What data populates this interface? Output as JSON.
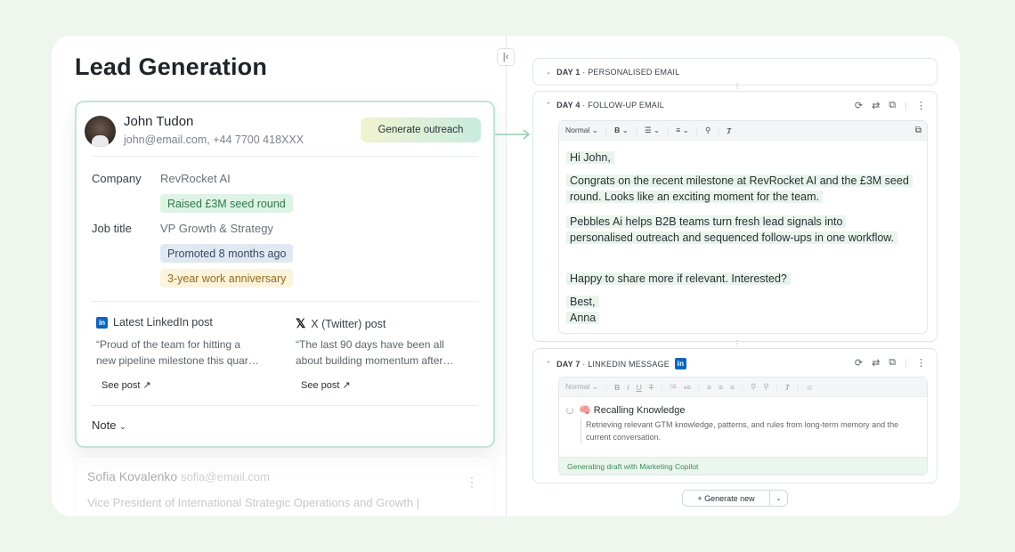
{
  "page": {
    "title": "Lead Generation"
  },
  "lead": {
    "name": "John Tudon",
    "contact": "john@email.com, +44 7700 418XXX",
    "generate_label": "Generate outreach",
    "company_label": "Company",
    "company": "RevRocket AI",
    "company_tag": "Raised £3M seed round",
    "job_label": "Job title",
    "job": "VP Growth & Strategy",
    "job_tags": [
      "Promoted 8 months ago",
      "3-year work anniversary"
    ],
    "linkedin": {
      "header": "Latest LinkedIn post",
      "lines": [
        "“Proud of the team for hitting a",
        "new pipeline milestone this quar…"
      ],
      "see": "See post ↗"
    },
    "twitter": {
      "header": "X (Twitter) post",
      "lines": [
        "“The last 90 days have been all",
        "about building momentum after…"
      ],
      "see": "See post ↗"
    },
    "note_label": "Note"
  },
  "next_lead": {
    "name": "Sofia Kovalenko",
    "email": "sofia@email.com",
    "title": "Vice President of International Strategic Operations and Growth |"
  },
  "sequence": {
    "day1": {
      "day": "DAY 1",
      "label": " · PERSONALISED EMAIL"
    },
    "day4": {
      "day": "DAY 4",
      "label": " · FOLLOW-UP EMAIL",
      "toolbar_style": "Normal",
      "body": {
        "greeting": "Hi John,",
        "p1": "Congrats on the recent milestone at RevRocket AI and the £3M seed round. Looks like an exciting moment for the team.",
        "p2": "Pebbles Ai helps B2B teams turn fresh lead signals into personalised outreach and sequenced follow-ups in one workflow.",
        "p3": "Happy to share more if relevant. Interested?",
        "signoff": "Best,",
        "signature": "Anna"
      }
    },
    "day7": {
      "day": "DAY 7",
      "label": " · LINKEDIN MESSAGE",
      "toolbar_style": "Normal",
      "recall_title": "🧠 Recalling Knowledge",
      "recall_desc": "Retrieving relevant GTM knowledge, patterns, and rules from long-term memory and the current conversation.",
      "generating": "Generating draft with Marketing Copilot"
    },
    "generate_new": "+ Generate new"
  },
  "colors": {
    "accent_green": "#bde8d6",
    "linkedin_blue": "#0a66c2"
  }
}
